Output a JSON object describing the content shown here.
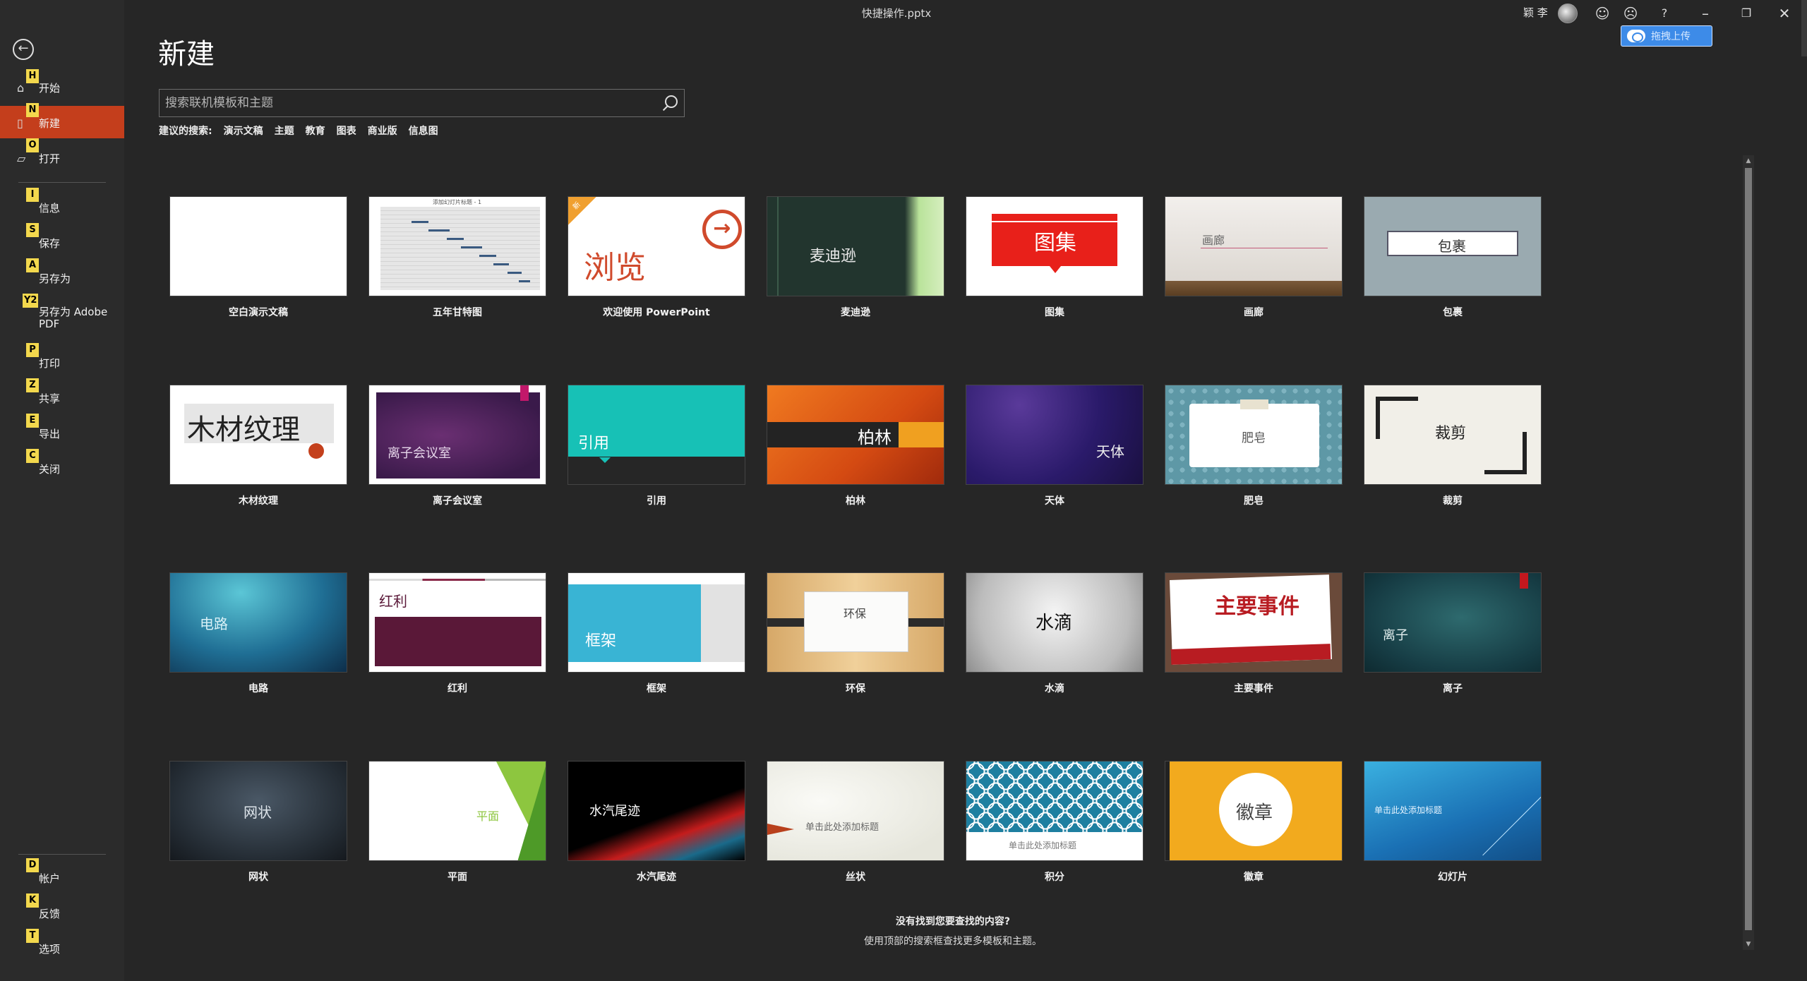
{
  "window": {
    "title": "快捷操作.pptx",
    "user_name": "颖 李",
    "icons": [
      "smile-icon",
      "frown-icon",
      "help-icon",
      "minimize-icon",
      "restore-icon",
      "close-icon"
    ],
    "help_glyph": "?",
    "upload_label": "拖拽上传"
  },
  "sidebar": {
    "items": [
      {
        "key": "H",
        "label": "开始",
        "icon": "home-icon"
      },
      {
        "key": "N",
        "label": "新建",
        "icon": "new-doc-icon",
        "active": true
      },
      {
        "key": "O",
        "label": "打开",
        "icon": "folder-icon"
      },
      {
        "key": "I",
        "label": "信息"
      },
      {
        "key": "S",
        "label": "保存"
      },
      {
        "key": "A",
        "label": "另存为"
      },
      {
        "key": "Y2",
        "label_line1": "另存为 Adobe",
        "label_line2": "PDF"
      },
      {
        "key": "P",
        "label": "打印"
      },
      {
        "key": "Z",
        "label": "共享"
      },
      {
        "key": "E",
        "label": "导出"
      },
      {
        "key": "C",
        "label": "关闭"
      }
    ],
    "bottom_items": [
      {
        "key": "D",
        "label": "帐户"
      },
      {
        "key": "K",
        "label": "反馈"
      },
      {
        "key": "T",
        "label": "选项"
      }
    ]
  },
  "main": {
    "title": "新建",
    "search_placeholder": "搜索联机模板和主题",
    "suggest_label": "建议的搜索:",
    "suggestions": [
      "演示文稿",
      "主题",
      "教育",
      "图表",
      "商业版",
      "信息图"
    ],
    "templates": [
      {
        "label": "空白演示文稿"
      },
      {
        "label": "五年甘特图",
        "thumb_text": "添加幻灯片标题 - 1"
      },
      {
        "label": "欢迎使用 PowerPoint",
        "thumb_text": "浏览",
        "badge": "新"
      },
      {
        "label": "麦迪逊",
        "thumb_text": "麦迪逊"
      },
      {
        "label": "图集",
        "thumb_text": "图集"
      },
      {
        "label": "画廊",
        "thumb_text": "画廊"
      },
      {
        "label": "包裹",
        "thumb_text": "包裹"
      },
      {
        "label": "木材纹理",
        "thumb_text": "木材纹理"
      },
      {
        "label": "离子会议室",
        "thumb_text": "离子会议室"
      },
      {
        "label": "引用",
        "thumb_text": "引用"
      },
      {
        "label": "柏林",
        "thumb_text": "柏林"
      },
      {
        "label": "天体",
        "thumb_text": "天体"
      },
      {
        "label": "肥皂",
        "thumb_text": "肥皂"
      },
      {
        "label": "裁剪",
        "thumb_text": "裁剪"
      },
      {
        "label": "电路",
        "thumb_text": "电路"
      },
      {
        "label": "红利",
        "thumb_text": "红利"
      },
      {
        "label": "框架",
        "thumb_text": "框架"
      },
      {
        "label": "环保",
        "thumb_text": "环保"
      },
      {
        "label": "水滴",
        "thumb_text": "水滴"
      },
      {
        "label": "主要事件",
        "thumb_text": "主要事件"
      },
      {
        "label": "离子",
        "thumb_text": "离子"
      },
      {
        "label": "网状",
        "thumb_text": "网状"
      },
      {
        "label": "平面",
        "thumb_text": "平面"
      },
      {
        "label": "水汽尾迹",
        "thumb_text": "水汽尾迹"
      },
      {
        "label": "丝状",
        "thumb_text": "单击此处添加标题"
      },
      {
        "label": "积分",
        "thumb_text": "单击此处添加标题"
      },
      {
        "label": "徽章",
        "thumb_text": "徽章"
      },
      {
        "label": "幻灯片",
        "thumb_text": "单击此处添加标题"
      }
    ],
    "footer_question": "没有找到您要查找的内容?",
    "footer_hint": "使用顶部的搜索框查找更多模板和主题。"
  },
  "colors": {
    "accent": "#c43e1c",
    "background": "#262626",
    "sidebar": "#2b2b2b",
    "keytip": "#f3d84d"
  }
}
